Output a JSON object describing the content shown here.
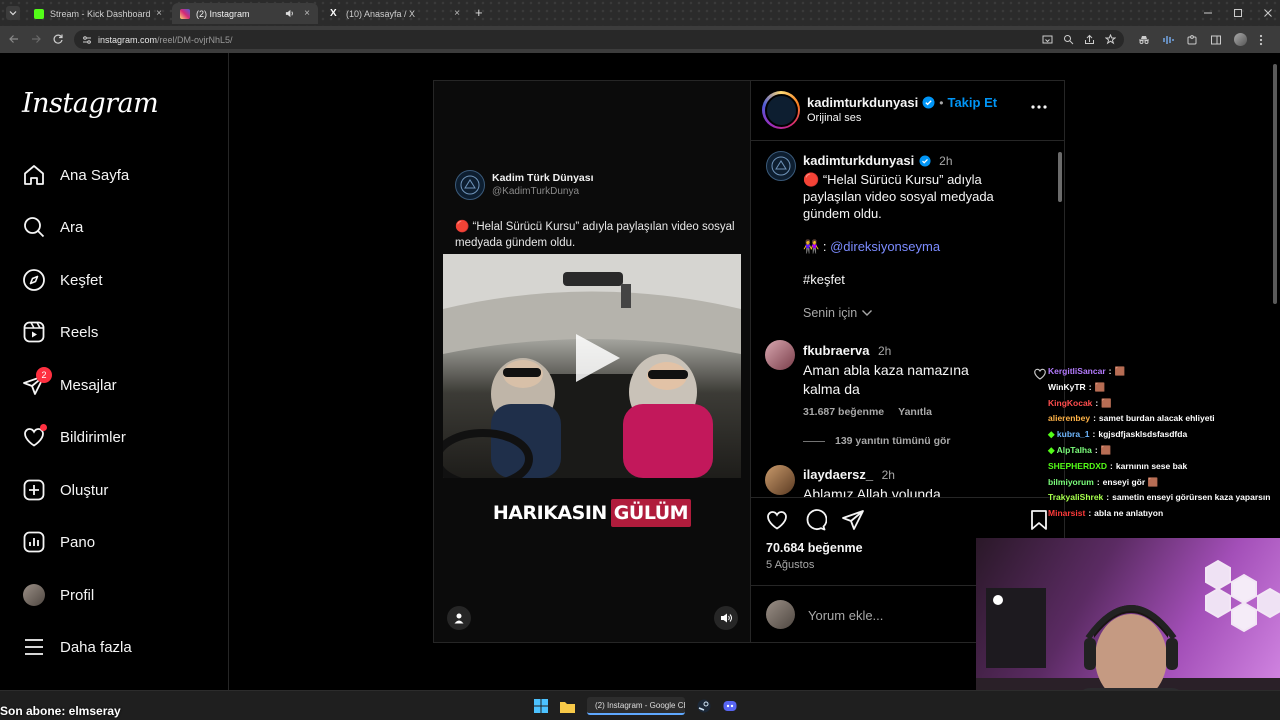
{
  "browser": {
    "tabs": [
      {
        "title": "Stream - Kick Dashboard",
        "favicon_color": "#53fc18"
      },
      {
        "title": "(2) Instagram",
        "favicon_color": "#d62976"
      },
      {
        "title": "(10) Anasayfa / X",
        "favicon_color": "#ffffff"
      }
    ],
    "tab_close": "×",
    "new_tab": "+",
    "url_host": "instagram.com",
    "url_path": "/reel/DM-ovjrNhL5/"
  },
  "sidebar": {
    "logo": "Instagram",
    "items": [
      {
        "label": "Ana Sayfa",
        "icon": "home-icon"
      },
      {
        "label": "Ara",
        "icon": "search-icon"
      },
      {
        "label": "Keşfet",
        "icon": "compass-icon"
      },
      {
        "label": "Reels",
        "icon": "reels-icon"
      },
      {
        "label": "Mesajlar",
        "icon": "messenger-icon",
        "badge": "2"
      },
      {
        "label": "Bildirimler",
        "icon": "heart-icon"
      },
      {
        "label": "Oluştur",
        "icon": "plus-square-icon"
      },
      {
        "label": "Pano",
        "icon": "dashboard-icon"
      },
      {
        "label": "Profil",
        "icon": "avatar"
      },
      {
        "label": "Daha fazla",
        "icon": "menu-icon"
      }
    ]
  },
  "reel": {
    "tweet_name": "Kadim Türk Dünyası",
    "tweet_handle": "@KadimTurkDunya",
    "tweet_emoji": "🔴",
    "tweet_text": "“Helal Sürücü Kursu” adıyla paylaşılan video sosyal medyada gündem oldu.",
    "caption_white": "HARIKASIN",
    "caption_highlight": "GÜLÜM"
  },
  "post": {
    "username": "kadimturkdunyasi",
    "follow_label": "Takip Et",
    "audio": "Orijinal ses",
    "separator": "•",
    "caption_time": "2h",
    "caption_emoji": "🔴",
    "caption_text": "“Helal Sürücü Kursu” adıyla paylaşılan video sosyal medyada gündem oldu.",
    "mention_emoji": "👭",
    "mention_prefix": ":",
    "mention": "@direksiyonseyma",
    "hashtag": "#keşfet",
    "translate_label": "Senin için",
    "comments": [
      {
        "user": "fkubraerva",
        "time": "2h",
        "text": "Aman abla kaza namazına kalma da",
        "likes": "31.687 beğenme",
        "reply": "Yanıtla",
        "view_replies": "139 yanıtın tümünü gör"
      },
      {
        "user": "ilaydaersz_",
        "time": "2h",
        "text": "Ablamız Allah yolunda"
      }
    ],
    "likes": "70.684 beğenme",
    "date": "5 Ağustos",
    "comment_placeholder": "Yorum ekle..."
  },
  "chat": [
    {
      "user": "KergitliSancar",
      "color": "#b57cff",
      "msg": "🟫"
    },
    {
      "user": "WinKyTR",
      "color": "#ffffff",
      "msg": "🟫"
    },
    {
      "user": "KingKocak",
      "color": "#ff4e4e",
      "msg": "🟫"
    },
    {
      "user": "alierenbey",
      "color": "#ffb347",
      "msg": "samet burdan alacak ehliyeti"
    },
    {
      "user": "kubra_1",
      "color": "#6fb8ff",
      "msg": "kgjsdfjasklsdsfasdfda",
      "badge": true
    },
    {
      "user": "AlpTalha",
      "color": "#7cff7c",
      "msg": "🟫",
      "badge": true
    },
    {
      "user": "SHEPHERDXD",
      "color": "#53fc18",
      "msg": "karnının sese bak"
    },
    {
      "user": "bilmiyorum",
      "color": "#7cff7c",
      "msg": "enseyi gör 🟫"
    },
    {
      "user": "TrakyaliShrek",
      "color": "#a6ff4d",
      "msg": "sametin enseyi görürsen kaza yaparsın"
    },
    {
      "user": "Minarsist",
      "color": "#ff3a3a",
      "msg": "abla ne anlatıyon"
    }
  ],
  "chat_separator": ":",
  "overlay": {
    "sub_alert": "Son abone: elmseray"
  },
  "taskbar": {
    "chrome_label": "(2) Instagram - Google Chrome"
  }
}
